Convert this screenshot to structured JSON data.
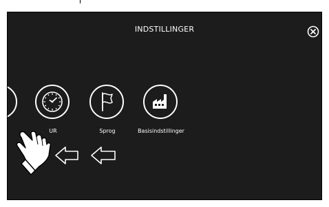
{
  "header": {
    "title": "INDSTILLINGER"
  },
  "items": [
    {
      "label": "UR",
      "icon": "clock-icon"
    },
    {
      "label": "Sprog",
      "icon": "flag-icon"
    },
    {
      "label": "Basisindstillinger",
      "icon": "factory-icon"
    }
  ],
  "icons": {
    "close": "close-circle-icon",
    "gesture": "hand-swipe-icon",
    "arrows": "arrow-left-icon"
  },
  "colors": {
    "screen_bg": "#1d1c1c",
    "foreground": "#ffffff"
  }
}
